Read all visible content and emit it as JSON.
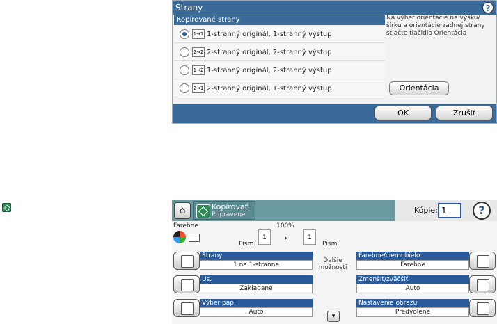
{
  "dialog": {
    "title": "Strany",
    "help_icon": "?",
    "list_header": "Kopírované strany",
    "options": [
      {
        "label": "1-stranný originál, 1-stranný výstup",
        "icon": "1→1",
        "selected": true
      },
      {
        "label": "2-stranný originál, 2-stranný výstup",
        "icon": "2→2",
        "selected": false
      },
      {
        "label": "1-stranný originál, 2-stranný výstup",
        "icon": "1→2",
        "selected": false
      },
      {
        "label": "2-stranný originál, 1-stranný výstup",
        "icon": "2→1",
        "selected": false
      }
    ],
    "info_text": "Na výber orientácie na výšku/šírku a orientácie zadnej strany stlačte tlačidlo Orientácia",
    "orientation_button": "Orientácia",
    "ok_button": "OK",
    "cancel_button": "Zrušiť"
  },
  "copy_screen": {
    "home_icon": "⌂",
    "tab_title": "Kopírovať",
    "tab_status": "Pripravené",
    "copies_label": "Kópie:",
    "copies_value": "1",
    "help_icon": "?",
    "color_label": "Farebne",
    "zoom_label": "100%",
    "paper_from": "1",
    "paper_to": "1",
    "paper_unit": "Písm.",
    "arrow": "▸",
    "more_options": "Ďalšie možnosti",
    "down_icon": "▾",
    "left_tiles": [
      {
        "label": "Strany",
        "value": "1 na 1-stranne"
      },
      {
        "label": "Us.",
        "value": "Zakladané"
      },
      {
        "label": "Výber pap.",
        "value": "Auto"
      }
    ],
    "right_tiles": [
      {
        "label": "Farebne/čiernobielo",
        "value": "Farebne"
      },
      {
        "label": "Zmenšiť/zväčšiť",
        "value": "Auto"
      },
      {
        "label": "Nastavenie obrazu",
        "value": "Predvolené"
      }
    ]
  }
}
